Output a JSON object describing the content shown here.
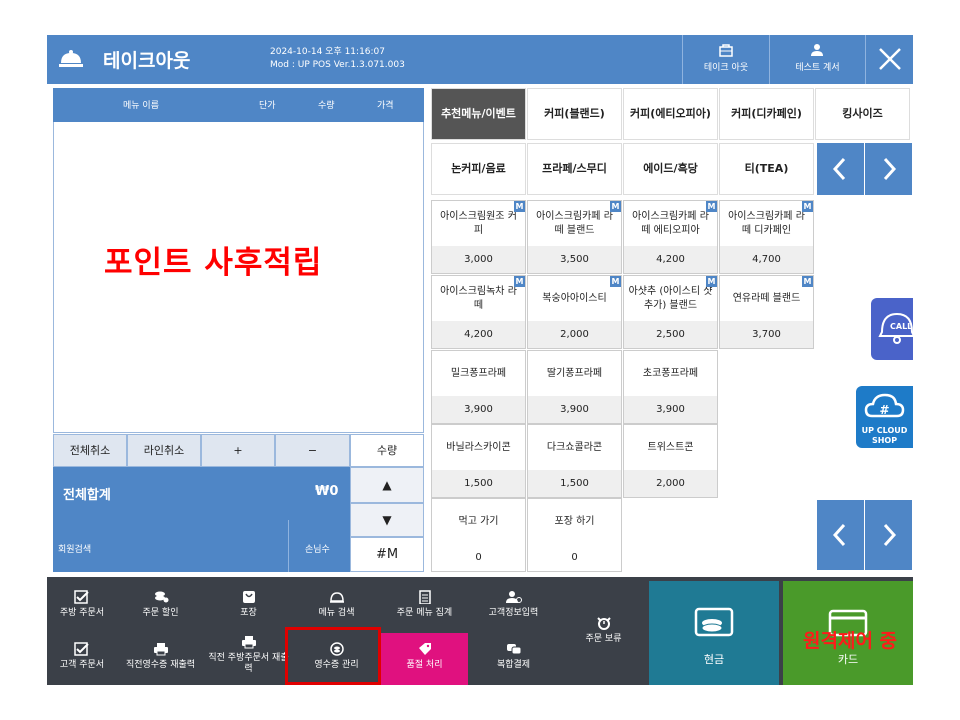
{
  "header": {
    "title": "테이크아웃",
    "datetime": "2024-10-14 오후 11:16:07",
    "version": "Mod : UP POS Ver.1.3.071.003",
    "takeout_label": "테이크 아웃",
    "test_label": "테스트 계서"
  },
  "order": {
    "columns": [
      "메뉴 이름",
      "단가",
      "수량",
      "가격"
    ],
    "overlay_text": "포인트 사후적립",
    "cancel_all": "전체취소",
    "cancel_line": "라인취소",
    "plus": "+",
    "minus": "−",
    "qty": "수량",
    "total_label": "전체합계",
    "total_value": "₩0",
    "up": "▲",
    "down": "▼",
    "member_search": "회원검색",
    "guest_count": "손님수",
    "m_button": "#M"
  },
  "categories": {
    "row1": [
      "추천메뉴/이벤트",
      "커피(블랜드)",
      "커피(에티오피아)",
      "커피(디카페인)",
      "킹사이즈"
    ],
    "row2": [
      "논커피/음료",
      "프라페/스무디",
      "에이드/흑당",
      "티(TEA)"
    ]
  },
  "menu": {
    "rows": [
      [
        {
          "name": "아이스크림원조 커피",
          "price": "3,000",
          "m": true
        },
        {
          "name": "아이스크림카페 라떼 블랜드",
          "price": "3,500",
          "m": true
        },
        {
          "name": "아이스크림카페 라떼 에티오피아",
          "price": "4,200",
          "m": true
        },
        {
          "name": "아이스크림카페 라떼 디카페인",
          "price": "4,700",
          "m": true
        }
      ],
      [
        {
          "name": "아이스크림녹차 라떼",
          "price": "4,200",
          "m": true
        },
        {
          "name": "복숭아아이스티",
          "price": "2,000",
          "m": true
        },
        {
          "name": "아샷추 (아이스티 샷추가) 블랜드",
          "price": "2,500",
          "m": true
        },
        {
          "name": "연유라떼 블랜드",
          "price": "3,700",
          "m": true
        }
      ],
      [
        {
          "name": "밀크퐁프라페",
          "price": "3,900",
          "m": false
        },
        {
          "name": "딸기퐁프라페",
          "price": "3,900",
          "m": false
        },
        {
          "name": "초코퐁프라페",
          "price": "3,900",
          "m": false
        }
      ],
      [
        {
          "name": "바닐라스카이콘",
          "price": "1,500",
          "m": false
        },
        {
          "name": "다크쇼콜라콘",
          "price": "1,500",
          "m": false
        },
        {
          "name": "트위스트콘",
          "price": "2,000",
          "m": false
        }
      ],
      [
        {
          "name": "먹고 가기",
          "price": "0",
          "m": false
        },
        {
          "name": "포장 하기",
          "price": "0",
          "m": false
        }
      ]
    ],
    "m_badge": "M"
  },
  "side": {
    "call_label": "CALL",
    "cloud_label1": "UP CLOUD",
    "cloud_label2": "SHOP"
  },
  "bottom": {
    "top_row": [
      "주방 주문서",
      "주문 할인",
      "포장",
      "메뉴 검색",
      "주문 메뉴 집계",
      "고객정보입력"
    ],
    "bottom_row": [
      "고객 주문서",
      "직전영수증 재출력",
      "직전 주방주문서 재출력",
      "영수증 관리",
      "품절 처리",
      "복합결제"
    ],
    "hold": "주문 보류",
    "cash": "현금",
    "card": "카드",
    "remote_text": "원격제어 중"
  },
  "colors": {
    "header_blue": "#4f86c6",
    "bottom_dark": "#3b4048",
    "cash_teal": "#1f7a94",
    "card_green": "#4a9a2a",
    "soldout_pink": "#e0117f",
    "highlight_red": "#e00000"
  }
}
